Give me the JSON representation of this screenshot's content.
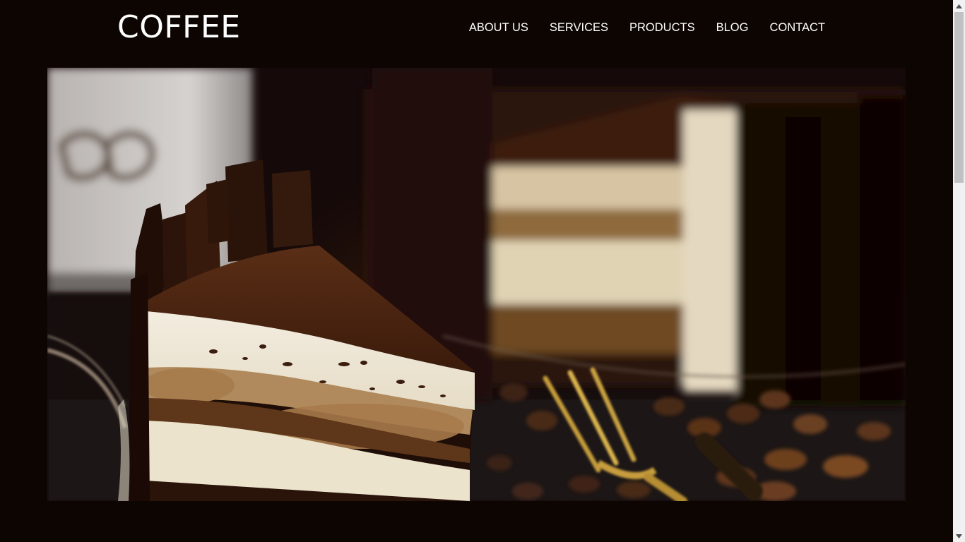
{
  "header": {
    "logo": "COFFEE",
    "nav": [
      "ABOUT US",
      "SERVICES",
      "PRODUCTS",
      "BLOG",
      "CONTACT"
    ]
  },
  "hero": {
    "image": "tiramisu-cake-slice-photo"
  },
  "colors": {
    "background": "#0d0502",
    "text": "#ffffff"
  }
}
